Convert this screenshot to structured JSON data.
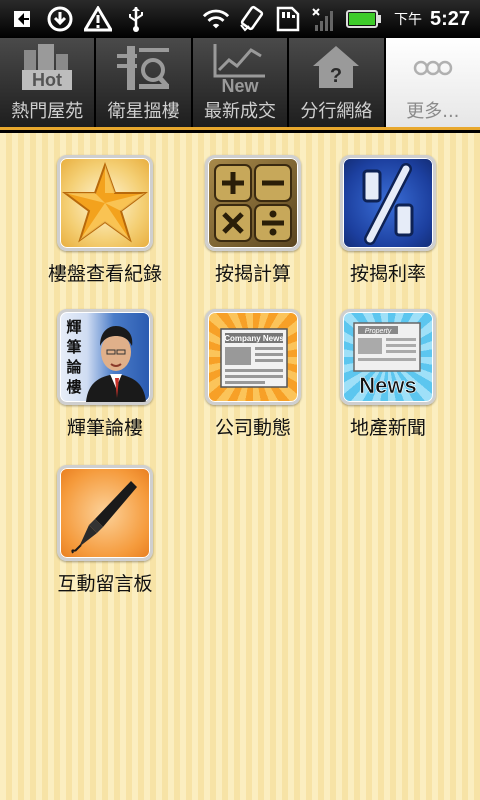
{
  "status_bar": {
    "ampm": "下午",
    "time": "5:27",
    "icons": [
      "usb-debug-icon",
      "download-icon",
      "warning-icon",
      "usb-icon",
      "wifi-icon",
      "rotate-icon",
      "sd-card-icon",
      "no-signal-icon",
      "battery-icon"
    ]
  },
  "tabs": [
    {
      "label": "熱門屋苑",
      "icon": "hot-building-icon",
      "badge": "Hot",
      "active": false
    },
    {
      "label": "衛星搵樓",
      "icon": "satellite-search-icon",
      "active": false
    },
    {
      "label": "最新成交",
      "icon": "new-chart-icon",
      "badge": "New",
      "active": false
    },
    {
      "label": "分行網絡",
      "icon": "branch-house-icon",
      "active": false
    },
    {
      "label": "更多...",
      "icon": "more-dots-icon",
      "active": true
    }
  ],
  "grid": [
    {
      "label": "樓盤查看紀錄",
      "icon": "star-icon"
    },
    {
      "label": "按揭計算",
      "icon": "calculator-icon"
    },
    {
      "label": "按揭利率",
      "icon": "percent-icon"
    },
    {
      "label": "輝筆論樓",
      "icon": "columnist-portrait-icon",
      "vertical_text": "輝筆論樓"
    },
    {
      "label": "公司動態",
      "icon": "company-news-icon",
      "caption": "Company News"
    },
    {
      "label": "地產新聞",
      "icon": "property-news-icon",
      "caption": "News",
      "sub_caption": "Property"
    },
    {
      "label": "互動留言板",
      "icon": "pen-icon"
    }
  ],
  "colors": {
    "accent": "#e8a82d",
    "background_stripe_a": "#fbeec0",
    "background_stripe_b": "#f7e3a6"
  }
}
